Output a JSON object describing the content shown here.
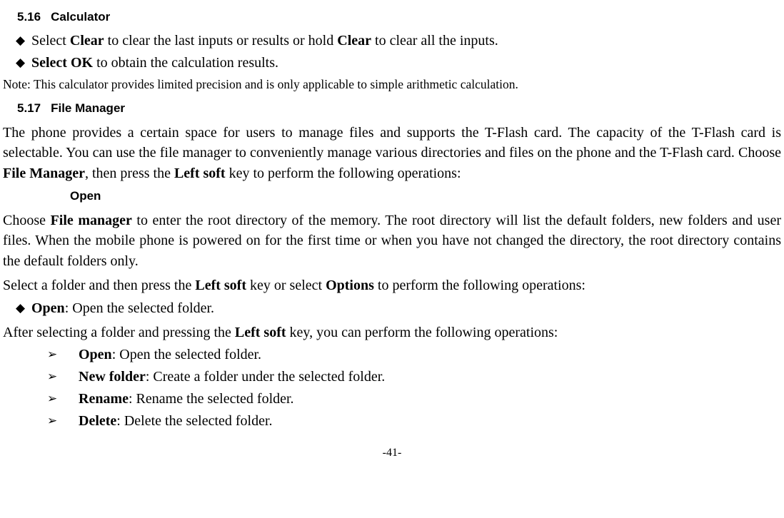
{
  "section516": {
    "num": "5.16",
    "title": "Calculator",
    "bullets": [
      {
        "pre": "Select ",
        "bold1": "Clear",
        "mid": " to clear the last inputs or results or hold ",
        "bold2": "Clear",
        "post": " to clear all the inputs."
      },
      {
        "bold1": "Select OK",
        "post": " to obtain the calculation results."
      }
    ],
    "note": "Note: This calculator provides limited precision and is only applicable to simple arithmetic calculation."
  },
  "section517": {
    "num": "5.17",
    "title": "File Manager",
    "intro": {
      "pre": "The phone provides a certain space for users to manage files and supports the T-Flash card. The capacity of the T-Flash card is selectable. You can use the file manager to conveniently manage various directories and files on the phone and the T-Flash card. Choose ",
      "bold1": "File Manager",
      "mid": ", then press the ",
      "bold2": "Left soft",
      "post": " key to perform the following operations:"
    },
    "subheading": "Open",
    "openPara": {
      "pre": "Choose ",
      "bold1": "File manager",
      "post": " to enter the root directory of the memory. The root directory will list the default folders, new folders and user files. When the mobile phone is powered on for the first time or when you have not changed the directory, the root directory contains the default folders only."
    },
    "selectLine": {
      "pre": "Select a folder and then press the ",
      "bold1": "Left soft",
      "mid": " key or select ",
      "bold2": "Options",
      "post": " to perform the following operations:"
    },
    "openBullet": {
      "bold1": "Open",
      "post": ": Open the selected folder."
    },
    "afterLine": {
      "pre": "After selecting a folder and pressing the ",
      "bold1": "Left soft",
      "post": " key, you can perform the following operations:"
    },
    "subBullets": [
      {
        "bold": "Open",
        "text": ": Open the selected folder."
      },
      {
        "bold": "New folder",
        "text": ": Create a folder under the selected folder."
      },
      {
        "bold": "Rename",
        "text": ": Rename the selected folder."
      },
      {
        "bold": "Delete",
        "text": ": Delete the selected folder."
      }
    ]
  },
  "pageNum": "-41-"
}
